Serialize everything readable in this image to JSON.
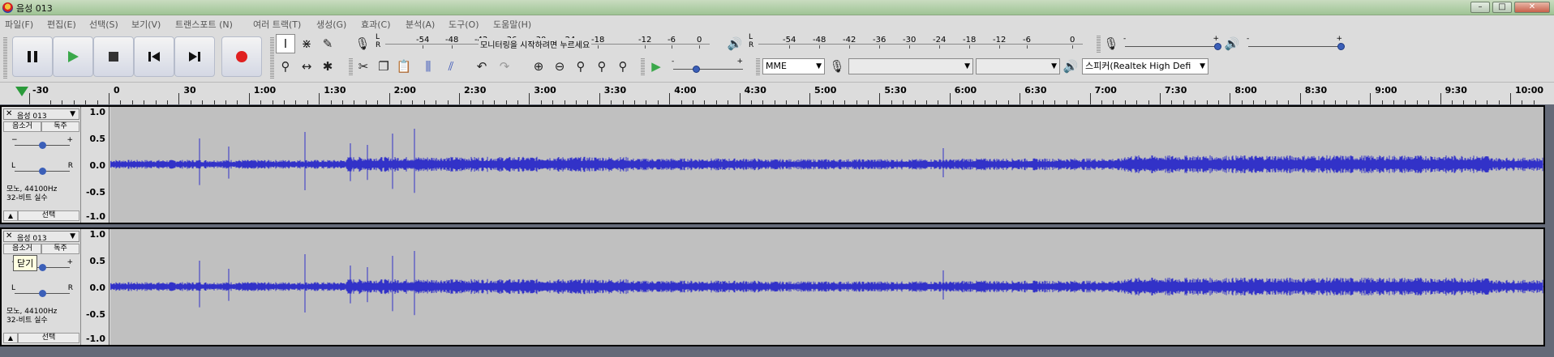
{
  "window": {
    "title": "음성 013",
    "minimize": "–",
    "maximize": "□",
    "close": "✕"
  },
  "menu": [
    "파일(F)",
    "편집(E)",
    "선택(S)",
    "보기(V)",
    "트랜스포트 (N)",
    "여러 트랙(T)",
    "생성(G)",
    "효과(C)",
    "분석(A)",
    "도구(O)",
    "도움말(H)"
  ],
  "transport": {
    "icons": [
      "pause-icon",
      "play-icon",
      "stop-icon",
      "skip-start-icon",
      "skip-end-icon",
      "record-icon"
    ]
  },
  "record_meter": {
    "l": "L",
    "r": "R",
    "ticks": [
      "-54",
      "-48",
      "-42",
      "-36",
      "-30",
      "-24",
      "-18",
      "-12",
      "-6",
      "0"
    ],
    "message": "모니터링을 시작하려면 누르세요"
  },
  "play_meter": {
    "l": "L",
    "r": "R",
    "ticks": [
      "-54",
      "-48",
      "-42",
      "-36",
      "-30",
      "-24",
      "-18",
      "-12",
      "-6",
      "0"
    ]
  },
  "mixer": {
    "record_volume": 1.0,
    "playback_volume": 1.0,
    "minus": "-",
    "plus": "+"
  },
  "play_speed": {
    "minus": "-",
    "plus": "+",
    "value": 0.35
  },
  "device": {
    "host": "MME",
    "recording_device": "",
    "channels": "",
    "playback_device": "스피커(Realtek High Defi"
  },
  "timeline": {
    "labels": [
      "-30",
      "0",
      "30",
      "1:00",
      "1:30",
      "2:00",
      "2:30",
      "3:00",
      "3:30",
      "4:00",
      "4:30",
      "5:00",
      "5:30",
      "6:00",
      "6:30",
      "7:00",
      "7:30",
      "8:00",
      "8:30",
      "9:00",
      "9:30",
      "10:00"
    ]
  },
  "tracks": [
    {
      "name": "음성 013",
      "mute": "음소거",
      "solo": "독주",
      "gain_minus": "−",
      "gain_plus": "+",
      "pan_l": "L",
      "pan_r": "R",
      "info1": "모노, 44100Hz",
      "info2": "32-비트 실수",
      "select": "선택",
      "gain": 0.5,
      "pan": 0.5,
      "scale": [
        "1.0",
        "0.5",
        "0.0",
        "-0.5",
        "-1.0"
      ]
    },
    {
      "name": "음성 013",
      "mute": "음소거",
      "solo": "독주",
      "gain_minus": "−",
      "gain_plus": "+",
      "pan_l": "L",
      "pan_r": "R",
      "info1": "모노, 44100Hz",
      "info2": "32-비트 실수",
      "select": "선택",
      "gain": 0.5,
      "pan": 0.5,
      "scale": [
        "1.0",
        "0.5",
        "0.0",
        "-0.5",
        "-1.0"
      ],
      "tooltip": "닫기"
    }
  ],
  "colors": {
    "waveform": "#3232c8",
    "wave_background": "#c0c0c0",
    "track_selected_border": "#000000"
  }
}
